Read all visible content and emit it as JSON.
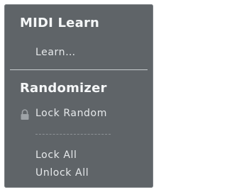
{
  "menu": {
    "midi_learn": {
      "title": "MIDI Learn",
      "learn_label": "Learn…"
    },
    "randomizer": {
      "title": "Randomizer",
      "lock_random_label": "Lock Random",
      "lock_all_label": "Lock All",
      "unlock_all_label": "Unlock All"
    },
    "icons": {
      "lock_random": "lock-icon"
    },
    "colors": {
      "background": "#5f6468",
      "text": "#eef1f3",
      "separator": "#c9cdd0"
    }
  }
}
